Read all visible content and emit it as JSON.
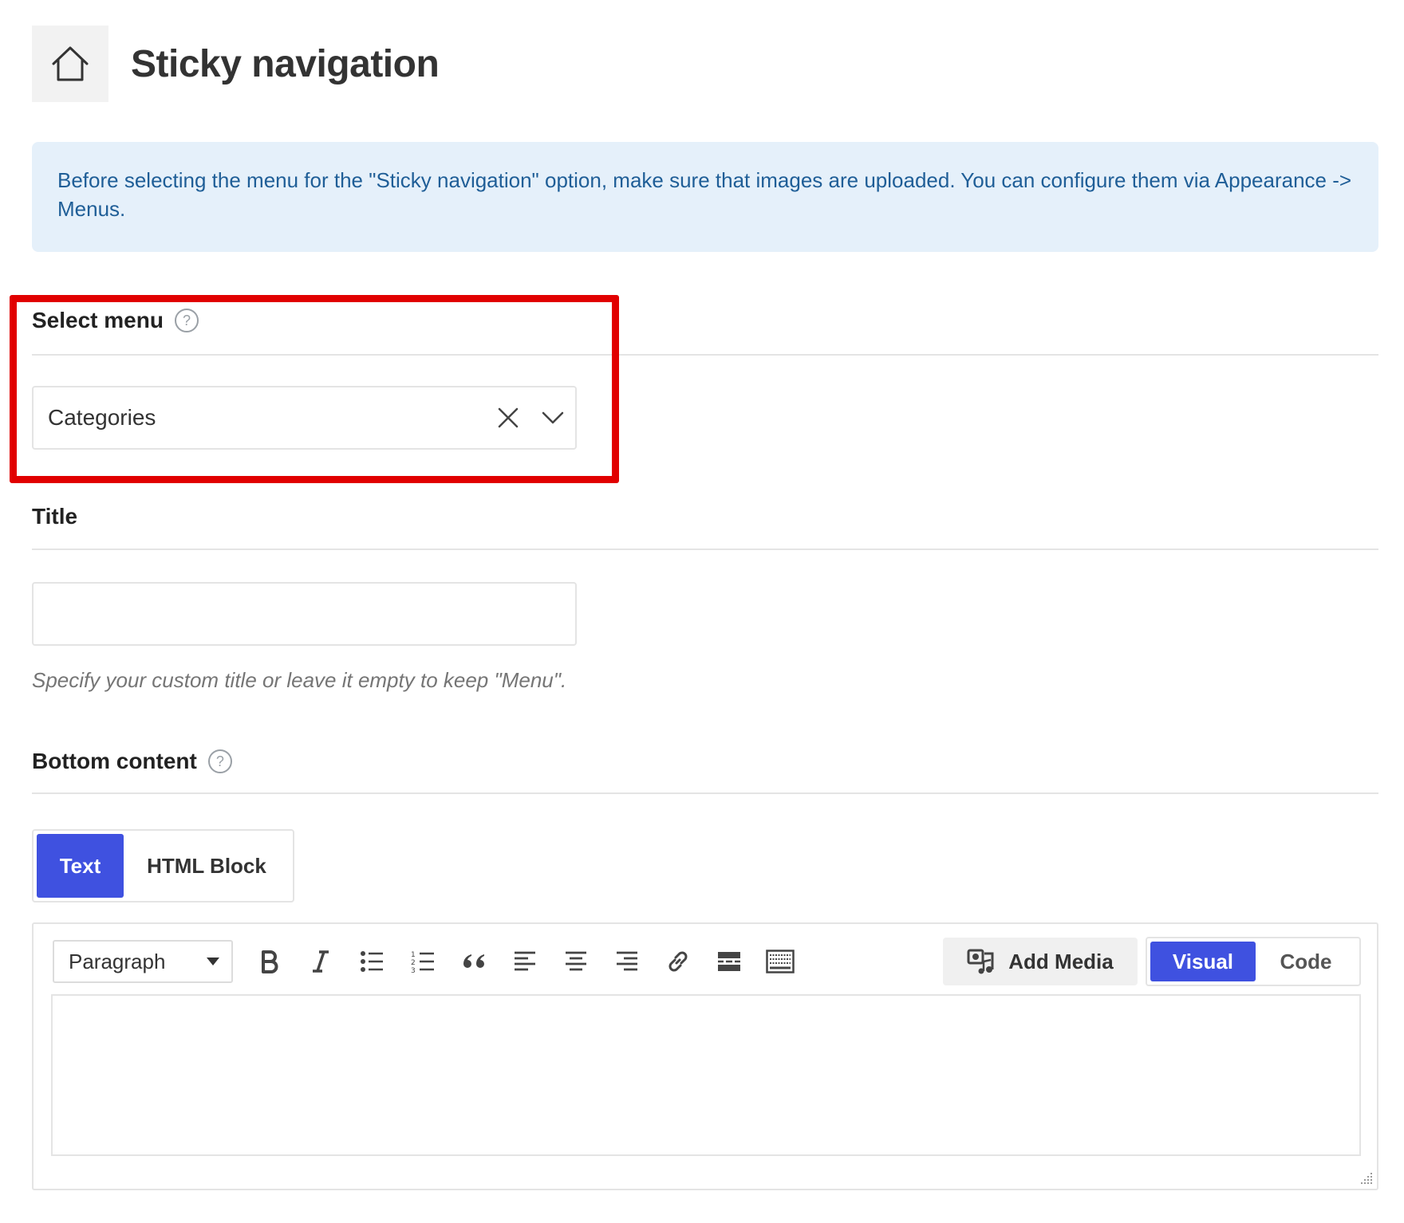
{
  "header": {
    "title": "Sticky navigation",
    "icon": "home-icon"
  },
  "notice": {
    "text": "Before selecting the menu for the \"Sticky navigation\" option, make sure that images are uploaded. You can configure them via Appearance -> Menus."
  },
  "select_menu": {
    "label": "Select menu",
    "help": "?",
    "value": "Categories",
    "highlight_color": "#e10000"
  },
  "title_field": {
    "label": "Title",
    "value": "",
    "hint": "Specify your custom title or leave it empty to keep \"Menu\"."
  },
  "bottom_content": {
    "label": "Bottom content",
    "help": "?",
    "tabs": [
      {
        "label": "Text",
        "active": true
      },
      {
        "label": "HTML Block",
        "active": false
      }
    ],
    "editor": {
      "format": "Paragraph",
      "toolbar_icons": [
        "bold-icon",
        "italic-icon",
        "bullet-list-icon",
        "numbered-list-icon",
        "blockquote-icon",
        "align-left-icon",
        "align-center-icon",
        "align-right-icon",
        "link-icon",
        "read-more-icon",
        "toolbar-toggle-icon"
      ],
      "add_media": "Add Media",
      "modes": [
        {
          "label": "Visual",
          "active": true
        },
        {
          "label": "Code",
          "active": false
        }
      ],
      "content": ""
    }
  },
  "colors": {
    "accent": "#3f51e0",
    "notice_bg": "#e5f0fa",
    "notice_text": "#1f5e97"
  }
}
